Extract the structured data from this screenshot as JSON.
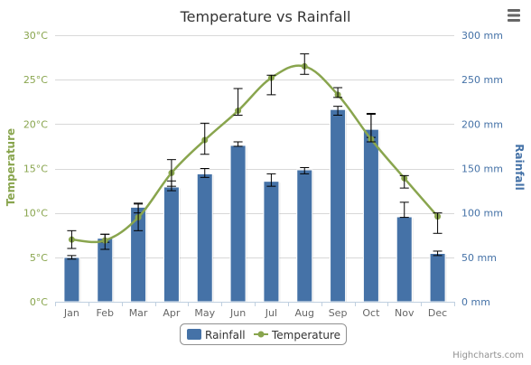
{
  "chart_data": {
    "type": "bar",
    "title": "Temperature vs Rainfall",
    "categories": [
      "Jan",
      "Feb",
      "Mar",
      "Apr",
      "May",
      "Jun",
      "Jul",
      "Aug",
      "Sep",
      "Oct",
      "Nov",
      "Dec"
    ],
    "y_left": {
      "label": "Temperature",
      "min": 0,
      "max": 30,
      "ticks": [
        "0°C",
        "5°C",
        "10°C",
        "15°C",
        "20°C",
        "25°C",
        "30°C"
      ],
      "tick_values": [
        0,
        5,
        10,
        15,
        20,
        25,
        30
      ],
      "color": "#89a54e"
    },
    "y_right": {
      "label": "Rainfall",
      "min": 0,
      "max": 300,
      "ticks": [
        "0 mm",
        "50 mm",
        "100 mm",
        "150 mm",
        "200 mm",
        "250 mm",
        "300 mm"
      ],
      "tick_values": [
        0,
        50,
        100,
        150,
        200,
        250,
        300
      ],
      "color": "#4572a7"
    },
    "series": [
      {
        "name": "Rainfall",
        "type": "column",
        "axis": "right",
        "color": "#4572a7",
        "values": [
          49.9,
          71.5,
          106.4,
          129.2,
          144.0,
          176.0,
          135.6,
          148.5,
          216.4,
          194.1,
          95.6,
          54.4
        ],
        "error_low": [
          48,
          67,
          100,
          125,
          140,
          175,
          130,
          144,
          210,
          185,
          95,
          52
        ],
        "error_high": [
          52,
          76,
          111,
          136,
          150,
          180,
          144,
          151,
          220,
          211,
          112,
          57
        ]
      },
      {
        "name": "Temperature",
        "type": "spline",
        "axis": "left",
        "color": "#89a54e",
        "values": [
          7.0,
          6.9,
          9.5,
          14.5,
          18.2,
          21.5,
          25.2,
          26.5,
          23.3,
          18.3,
          13.9,
          9.6
        ],
        "error_low": [
          6,
          5.9,
          8.0,
          13.0,
          16.6,
          21.0,
          23.3,
          25.6,
          23.0,
          18.0,
          12.8,
          7.7
        ],
        "error_high": [
          8,
          7.6,
          11.0,
          16.0,
          20.1,
          24.0,
          25.5,
          27.9,
          24.1,
          21.2,
          14.2,
          10.0
        ]
      }
    ],
    "grid": true,
    "legend_position": "bottom-center"
  },
  "ui": {
    "menu_icon": "hamburger-menu-icon",
    "credits": "Highcharts.com",
    "colors": {
      "grid": "#d8d8d8",
      "axis_line": "#c0d0e0",
      "text": "#333333"
    }
  }
}
